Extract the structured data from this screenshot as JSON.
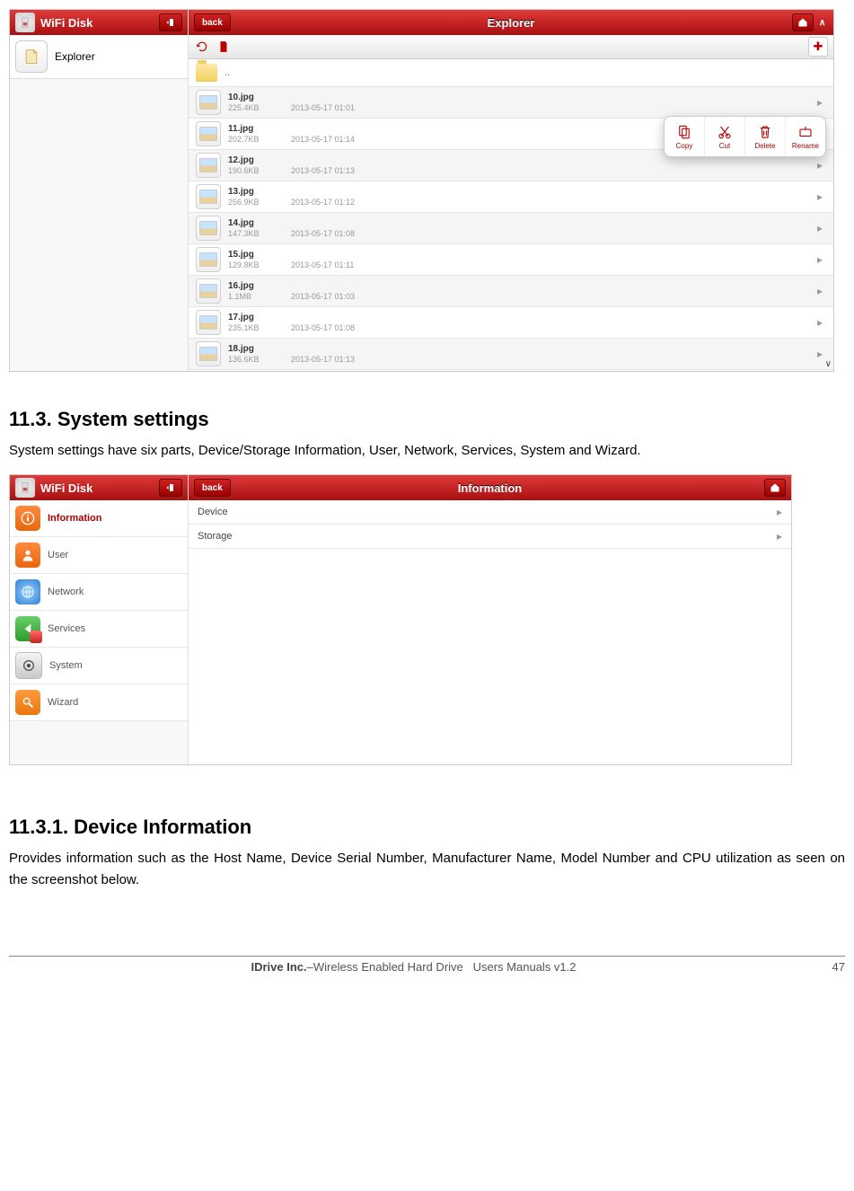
{
  "screenshot1": {
    "leftHeaderTitle": "WiFi Disk",
    "explorerLabel": "Explorer",
    "mainHeaderTitle": "Explorer",
    "backLabel": "back",
    "upFolderLabel": "..",
    "files": [
      {
        "name": "10.jpg",
        "size": "225.4KB",
        "date": "2013-05-17 01:01"
      },
      {
        "name": "11.jpg",
        "size": "202.7KB",
        "date": "2013-05-17 01:14"
      },
      {
        "name": "12.jpg",
        "size": "190.6KB",
        "date": "2013-05-17 01:13"
      },
      {
        "name": "13.jpg",
        "size": "256.9KB",
        "date": "2013-05-17 01:12"
      },
      {
        "name": "14.jpg",
        "size": "147.3KB",
        "date": "2013-05-17 01:08"
      },
      {
        "name": "15.jpg",
        "size": "129.8KB",
        "date": "2013-05-17 01:11"
      },
      {
        "name": "16.jpg",
        "size": "1.1MB",
        "date": "2013-05-17 01:03"
      },
      {
        "name": "17.jpg",
        "size": "235.1KB",
        "date": "2013-05-17 01:08"
      },
      {
        "name": "18.jpg",
        "size": "136.6KB",
        "date": "2013-05-17 01:13"
      }
    ],
    "context": {
      "copy": "Copy",
      "cut": "Cut",
      "delete": "Delete",
      "rename": "Rename"
    }
  },
  "section1": {
    "heading": "11.3. System settings",
    "para": "System settings have six parts, Device/Storage Information, User, Network, Services, System and Wizard."
  },
  "screenshot2": {
    "leftHeaderTitle": "WiFi Disk",
    "mainHeaderTitle": "Information",
    "backLabel": "back",
    "nav": {
      "information": "Information",
      "user": "User",
      "network": "Network",
      "services": "Services",
      "system": "System",
      "wizard": "Wizard"
    },
    "rows": {
      "device": "Device",
      "storage": "Storage"
    }
  },
  "section2": {
    "heading": "11.3.1. Device Information",
    "para": "Provides information such as the Host Name, Device Serial Number, Manufacturer Name,  Model Number and CPU utilization as seen on the screenshot below."
  },
  "footer": {
    "company": "IDrive Inc.",
    "sub1": "–Wireless Enabled Hard Drive",
    "sub2": "Users Manuals v1.2",
    "page": "47"
  }
}
